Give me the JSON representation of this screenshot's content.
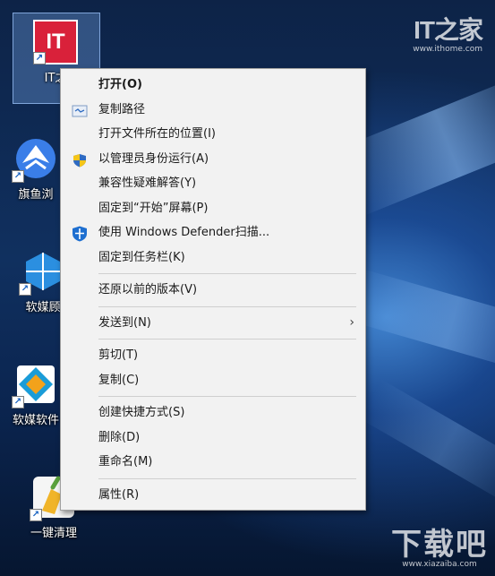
{
  "desktop": {
    "icons": [
      {
        "label": "IT之",
        "tile_text": "IT"
      },
      {
        "label": "旗鱼浏"
      },
      {
        "label": "软媒顾"
      },
      {
        "label": "软媒软件"
      },
      {
        "label": "一键清理"
      }
    ],
    "shortcut_glyph": "↗"
  },
  "watermarks": {
    "top_logo": "IT之家",
    "top_url": "www.ithome.com",
    "bottom_logo": "下载吧",
    "bottom_url": "www.xiazaiba.com"
  },
  "context_menu": {
    "items": [
      {
        "label": "打开(O)"
      },
      {
        "label": "复制路径"
      },
      {
        "label": "打开文件所在的位置(I)"
      },
      {
        "label": "以管理员身份运行(A)"
      },
      {
        "label": "兼容性疑难解答(Y)"
      },
      {
        "label": "固定到“开始”屏幕(P)"
      },
      {
        "label": "使用 Windows Defender扫描..."
      },
      {
        "label": "固定到任务栏(K)"
      },
      {
        "label": "还原以前的版本(V)"
      },
      {
        "label": "发送到(N)"
      },
      {
        "label": "剪切(T)"
      },
      {
        "label": "复制(C)"
      },
      {
        "label": "创建快捷方式(S)"
      },
      {
        "label": "删除(D)"
      },
      {
        "label": "重命名(M)"
      },
      {
        "label": "属性(R)"
      }
    ],
    "submenu_arrow": "›"
  },
  "colors": {
    "menu_bg": "#f2f2f2",
    "ithome_red": "#d9213a",
    "defender_blue": "#1e6fd0"
  }
}
